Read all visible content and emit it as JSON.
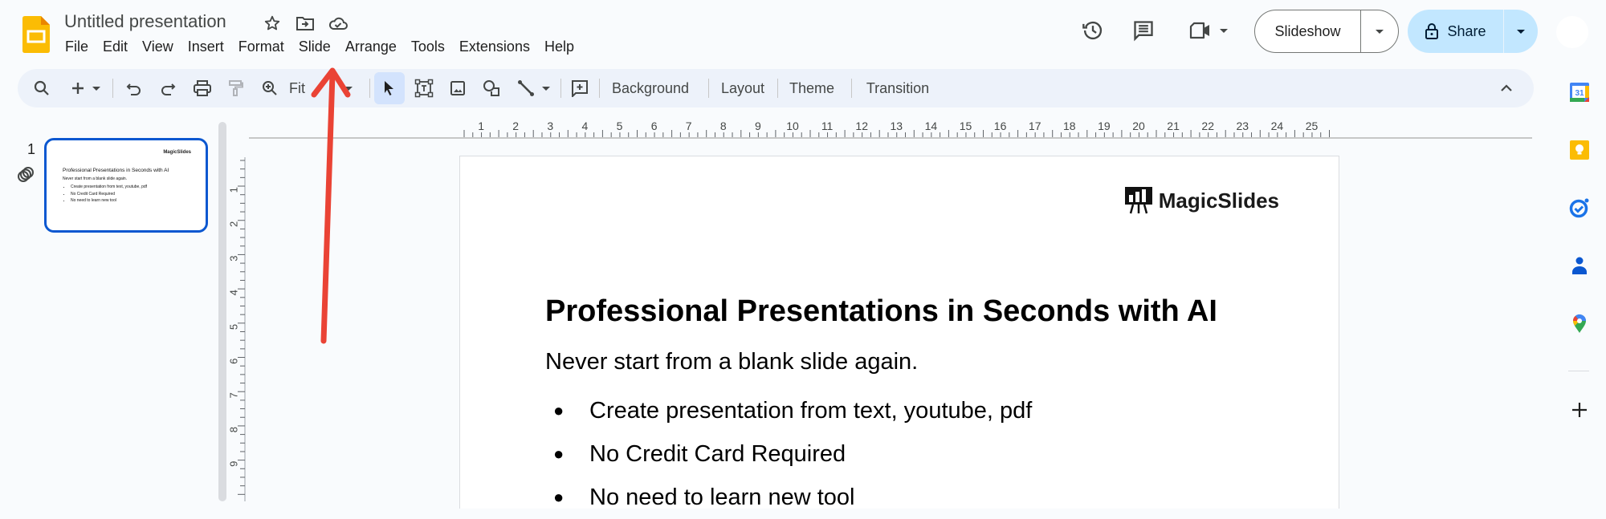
{
  "app": {
    "name": "Google Slides",
    "document_title": "Untitled presentation",
    "title_icons": [
      "star-icon",
      "move-to-folder-icon",
      "cloud-saved-icon"
    ],
    "menu": [
      "File",
      "Edit",
      "View",
      "Insert",
      "Format",
      "Slide",
      "Arrange",
      "Tools",
      "Extensions",
      "Help"
    ]
  },
  "header_actions": {
    "icons": [
      "version-history-icon",
      "comments-icon",
      "meet-icon"
    ],
    "slideshow_label": "Slideshow",
    "share_label": "Share"
  },
  "toolbar": {
    "zoom_label": "Fit",
    "buttons": [
      "Background",
      "Layout",
      "Theme",
      "Transition"
    ]
  },
  "filmstrip": {
    "slides": [
      {
        "number": "1",
        "selected": true
      }
    ]
  },
  "rulers": {
    "horizontal_labels": [
      "1",
      "2",
      "3",
      "4",
      "5",
      "6",
      "7",
      "8",
      "9",
      "10",
      "11",
      "12",
      "13",
      "14",
      "15",
      "16",
      "17",
      "18",
      "19",
      "20",
      "21",
      "22",
      "23",
      "24",
      "25"
    ],
    "vertical_labels": [
      "1",
      "2",
      "3",
      "4",
      "5",
      "6",
      "7",
      "8",
      "9"
    ]
  },
  "slide": {
    "logo_text": "MagicSlides",
    "title": "Professional Presentations in Seconds with AI",
    "subtitle": "Never start from a blank slide again.",
    "bullets": [
      "Create presentation from text, youtube, pdf",
      "No Credit Card Required",
      "No need to learn new tool"
    ]
  },
  "side_panel": {
    "apps": [
      "Calendar",
      "Keep",
      "Tasks",
      "Contacts",
      "Maps"
    ],
    "calendar_day": "31"
  },
  "colors": {
    "accent": "#0b57d0",
    "share_bg": "#c2e7ff",
    "toolbar_bg": "#edf2fa",
    "annotation": "#ea4335"
  }
}
